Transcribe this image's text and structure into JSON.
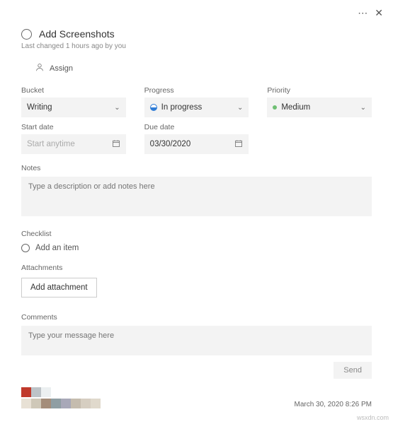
{
  "header": {
    "title": "Add Screenshots",
    "meta": "Last changed 1 hours ago by you"
  },
  "assign": {
    "label": "Assign"
  },
  "fields": {
    "bucket": {
      "label": "Bucket",
      "value": "Writing"
    },
    "progress": {
      "label": "Progress",
      "value": "In progress"
    },
    "priority": {
      "label": "Priority",
      "value": "Medium"
    },
    "start_date": {
      "label": "Start date",
      "placeholder": "Start anytime",
      "value": ""
    },
    "due_date": {
      "label": "Due date",
      "value": "03/30/2020"
    }
  },
  "notes": {
    "label": "Notes",
    "placeholder": "Type a description or add notes here"
  },
  "checklist": {
    "label": "Checklist",
    "add_item": "Add an item"
  },
  "attachments": {
    "label": "Attachments",
    "button": "Add attachment"
  },
  "comments": {
    "label": "Comments",
    "placeholder": "Type your message here",
    "send": "Send"
  },
  "footer": {
    "timestamp": "March 30, 2020 8:26 PM",
    "palette_row1": [
      "#c0392b",
      "#bdc3c7",
      "#ecf0f1"
    ],
    "palette_row2": [
      "#e8e1d5",
      "#cfc8b8",
      "#a48d7a",
      "#8f9ea3",
      "#a8a8b8",
      "#c5bcae",
      "#d6cec1",
      "#e0d9cc"
    ]
  },
  "watermark": "wsxdn.com"
}
